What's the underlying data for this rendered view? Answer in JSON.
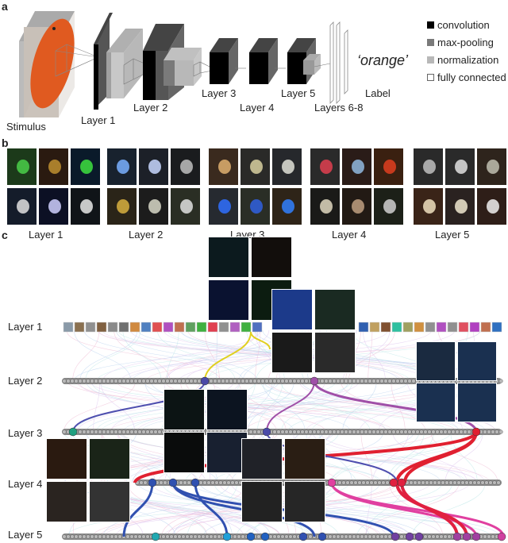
{
  "panel_a": {
    "letter": "a",
    "stimulus_label": "Stimulus",
    "layers": [
      "Layer 1",
      "Layer 2",
      "Layer 3",
      "Layer 4",
      "Layer 5",
      "Layers 6-8"
    ],
    "label_text": "Label",
    "output_label": "‘orange’",
    "legend": [
      {
        "label": "convolution",
        "color": "#000000"
      },
      {
        "label": "max-pooling",
        "color": "#7a7a7a"
      },
      {
        "label": "normalization",
        "color": "#b8b8b8"
      },
      {
        "label": "fully connected",
        "color": "#ffffff"
      }
    ]
  },
  "panel_b": {
    "letter": "b",
    "groups": [
      {
        "label": "Layer 1",
        "tiles": [
          "#1c3a1a",
          "#2a1a10",
          "#0a1a2a",
          "#141c2a",
          "#0c1024",
          "#101418"
        ],
        "accents": [
          "#4ad04a",
          "#c09030",
          "#3ee040",
          "#e0e0e0",
          "#d0d0ff",
          "#e8e8e8"
        ]
      },
      {
        "label": "Layer 2",
        "tiles": [
          "#18222e",
          "#1c2028",
          "#1a1c1e",
          "#2a2418",
          "#1c1c1c",
          "#2a2e24"
        ],
        "accents": [
          "#7ab0ff",
          "#c8d8ff",
          "#c0c0c0",
          "#d8b040",
          "#d8d8c8",
          "#e0e0e0"
        ]
      },
      {
        "label": "Layer 3",
        "tiles": [
          "#3a2a1e",
          "#2a2a28",
          "#26282c",
          "#262a30",
          "#2a2e26",
          "#2e2418"
        ],
        "accents": [
          "#e0b070",
          "#d8d0a0",
          "#e0e0d8",
          "#3070ff",
          "#3060e0",
          "#3080ff"
        ]
      },
      {
        "label": "Layer 4",
        "tiles": [
          "#2a2a2a",
          "#2a1c18",
          "#3a2010",
          "#1a1a18",
          "#221a14",
          "#1c2018"
        ],
        "accents": [
          "#e04050",
          "#90b8e0",
          "#e04020",
          "#e0d8c0",
          "#c0a080",
          "#d0d0d0"
        ]
      },
      {
        "label": "Layer 5",
        "tiles": [
          "#2a2a2a",
          "#2a2a2a",
          "#2e241c",
          "#3a2418",
          "#2a2220",
          "#2e1e18"
        ],
        "accents": [
          "#c0c0c0",
          "#e0e0e0",
          "#c0c0b0",
          "#f0e0c0",
          "#f0e8d0",
          "#f0f0f0"
        ]
      }
    ]
  },
  "panel_c": {
    "letter": "c",
    "layer_labels": [
      "Layer 1",
      "Layer 2",
      "Layer 3",
      "Layer 4",
      "Layer 5"
    ],
    "layer1_filters_left": [
      "#8a9aa8",
      "#8a7050",
      "#909090",
      "#806040",
      "#8a8a8a",
      "#707070",
      "#d08a40",
      "#5080c0",
      "#e05050",
      "#b050c0",
      "#c07050",
      "#60a060",
      "#40b040",
      "#e04050",
      "#909090",
      "#b060c0",
      "#40b040",
      "#5070c0"
    ],
    "layer1_filters_right": [
      "#3060b0",
      "#c0a060",
      "#805030",
      "#30c0a0",
      "#a0a060",
      "#d09040",
      "#909090",
      "#b050c0",
      "#909090",
      "#e05060",
      "#b040c0",
      "#c07050",
      "#3070c0"
    ],
    "node_colors": {
      "layer2": [
        "#4a4aa8",
        "#a050a8"
      ],
      "layer3": [
        "#20a080",
        "#4a4aa8",
        "#e02030"
      ],
      "layer4": [
        "#3050b0",
        "#3050b0",
        "#3050b0",
        "#e040a0",
        "#e02040",
        "#e02040"
      ],
      "layer5": [
        "#20a8b0",
        "#20a0d8",
        "#2060c0",
        "#2060c0",
        "#3050b0",
        "#3050b0",
        "#7040a0",
        "#7040a0",
        "#7040a0",
        "#a040a0",
        "#a040a0",
        "#a040a0",
        "#d040a0"
      ]
    }
  }
}
